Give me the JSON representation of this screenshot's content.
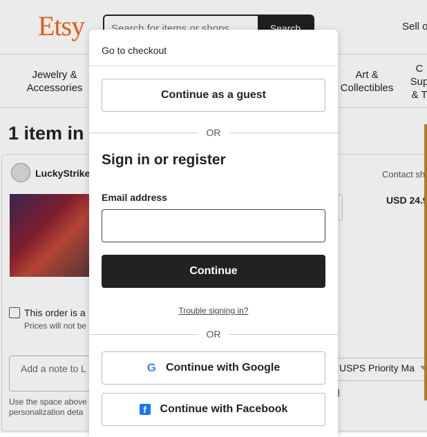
{
  "header": {
    "logo": "Etsy",
    "search_placeholder": "Search for items or shops",
    "search_button": "Search",
    "sell_link": "Sell o"
  },
  "categories": [
    {
      "line1": "Jewelry &",
      "line2": "Accessories"
    },
    {
      "line1": "Art &",
      "line2": "Collectibles"
    },
    {
      "line1": "C",
      "line2": "Sup",
      "line3": "& T"
    }
  ],
  "cart": {
    "title": "1 item in y",
    "shop_name": "LuckyStrike",
    "contact_link": "Contact sh",
    "price": "USD 24.9",
    "gift_label": "This order is a",
    "gift_sub": "Prices will not be",
    "note_placeholder": "Add a note to L",
    "note_help_line1": "Use the space above",
    "note_help_line2": "personalization deta",
    "shipping_option": "USPS Priority Ma",
    "shipping_fragment": "8"
  },
  "modal": {
    "title": "Go to checkout",
    "guest_button": "Continue as a guest",
    "or_text": "OR",
    "signin_title": "Sign in or register",
    "email_label": "Email address",
    "email_value": "",
    "continue_button": "Continue",
    "trouble_link": "Trouble signing in?",
    "google_button": "Continue with Google",
    "facebook_button": "Continue with Facebook",
    "google_icon": "google-icon",
    "facebook_icon": "facebook-icon"
  },
  "colors": {
    "brand": "#f1641e",
    "dark_button": "#222222",
    "facebook_blue": "#1877f2"
  }
}
